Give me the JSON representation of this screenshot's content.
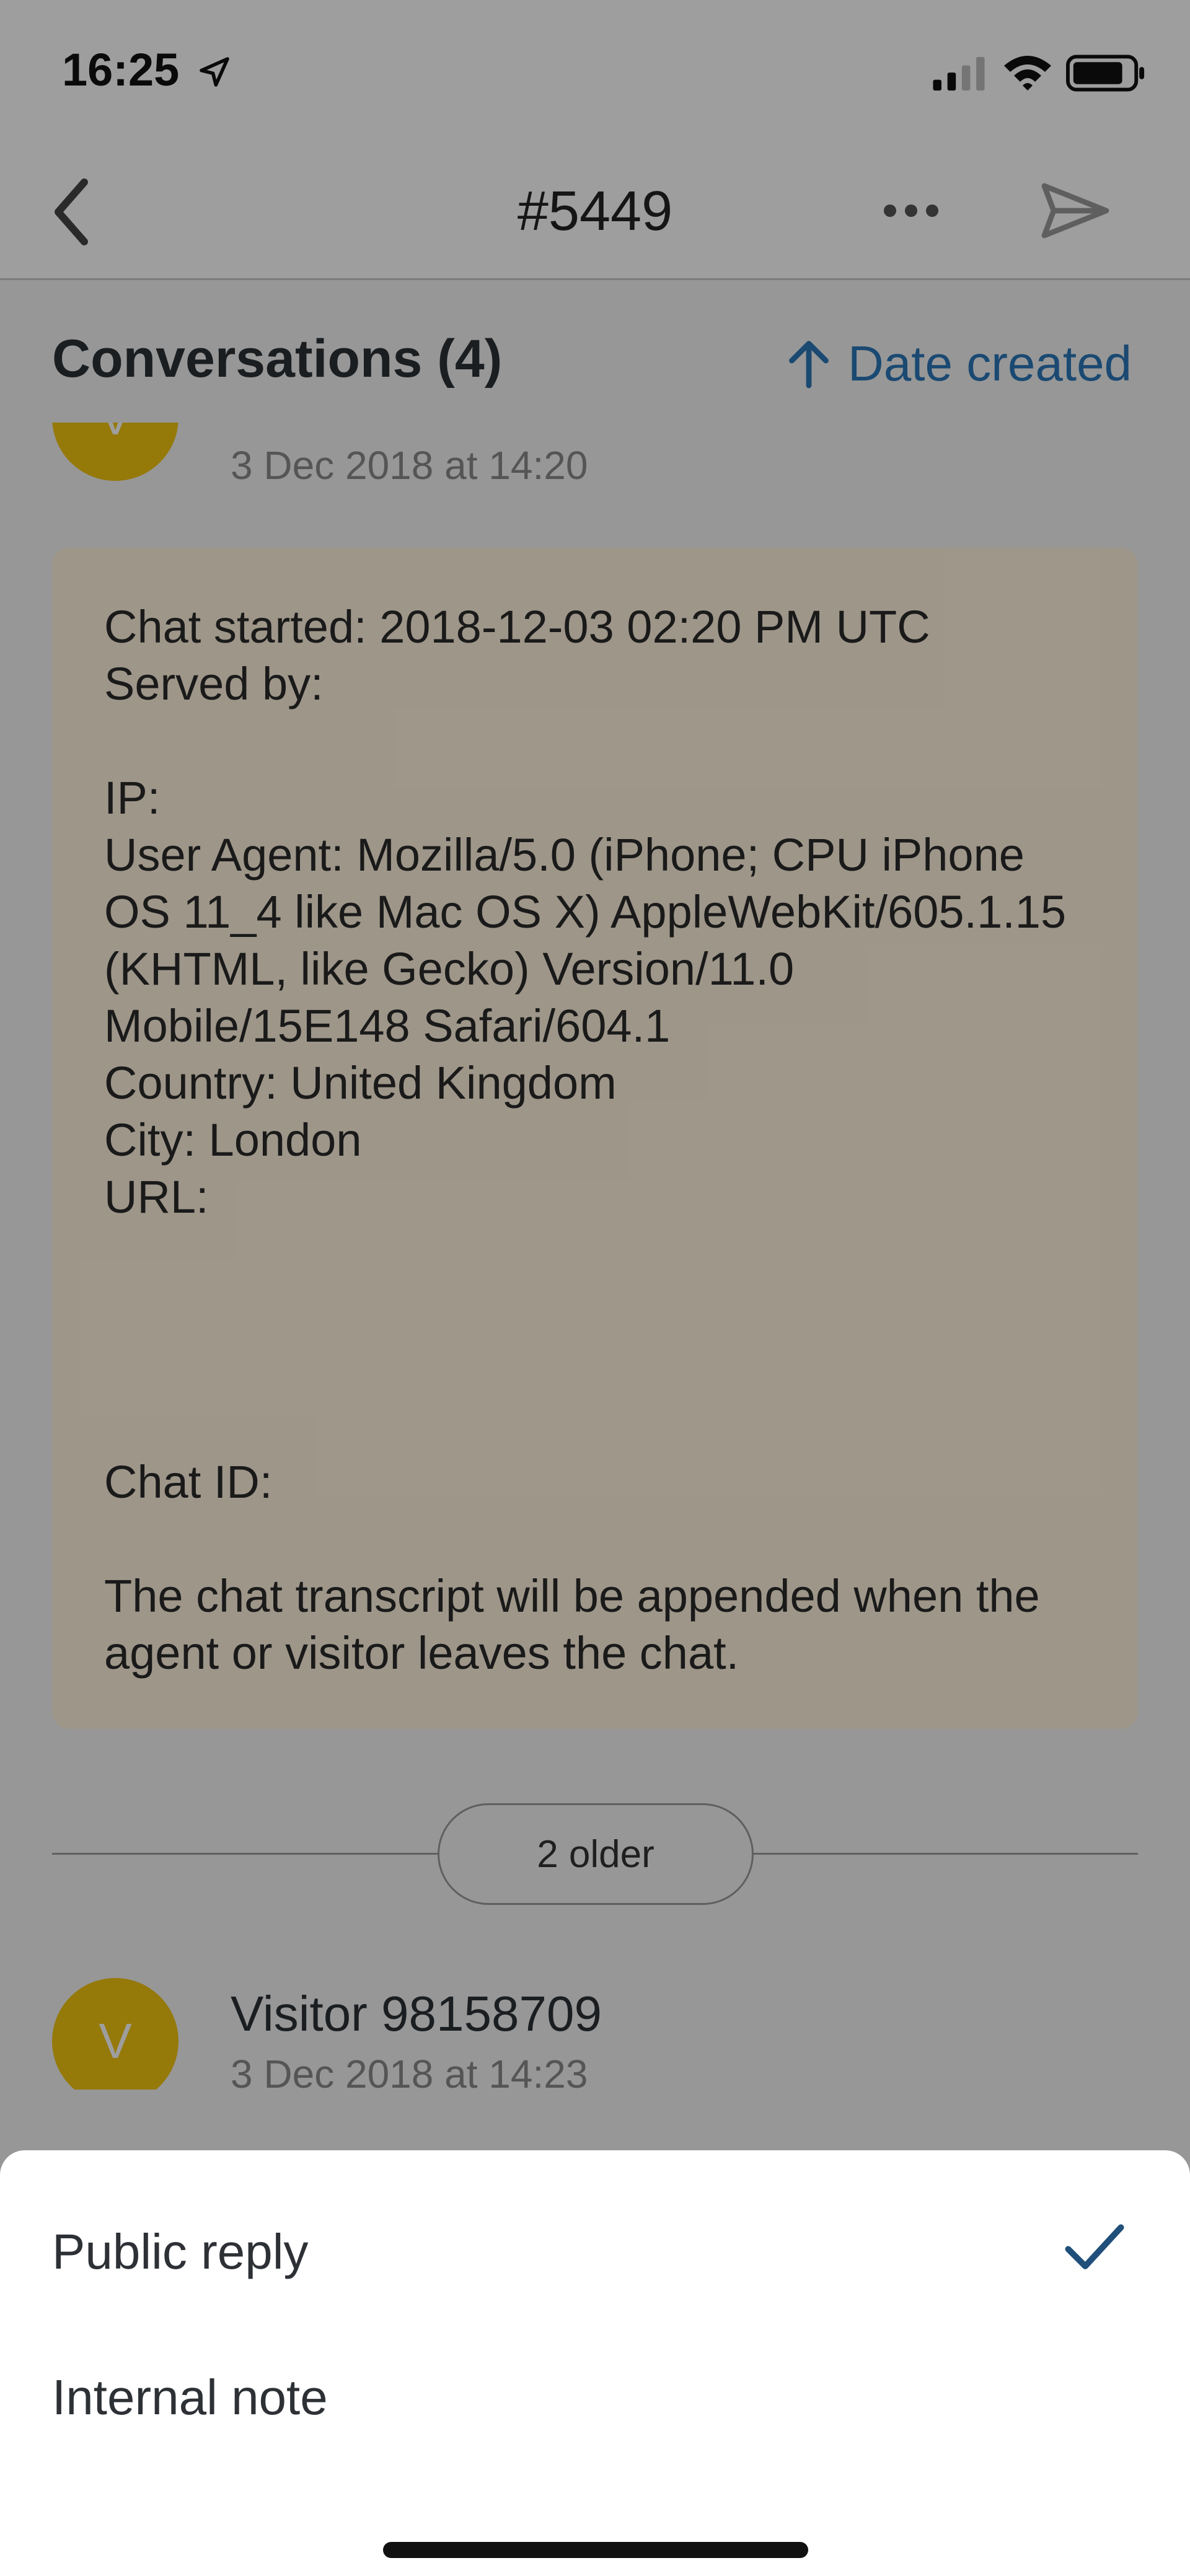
{
  "status_bar": {
    "time": "16:25"
  },
  "nav": {
    "title": "#5449"
  },
  "conversations": {
    "title": "Conversations (4)",
    "sort_label": "Date created"
  },
  "first_message": {
    "avatar_initial": "V",
    "date": "3 Dec 2018 at 14:20",
    "body": "Chat started: 2018-12-03 02:20 PM UTC\nServed by:\n\nIP:\nUser Agent: Mozilla/5.0 (iPhone; CPU iPhone OS 11_4 like Mac OS X) AppleWebKit/605.1.15 (KHTML, like Gecko) Version/11.0 Mobile/15E148 Safari/604.1\nCountry: United Kingdom\nCity: London\nURL:\n\n\n\n\nChat ID:\n\nThe chat transcript will be appended when the agent or visitor leaves the chat."
  },
  "older_button": {
    "label": "2 older"
  },
  "second_message": {
    "avatar_initial": "V",
    "name": "Visitor 98158709",
    "date": "3 Dec 2018 at 14:23"
  },
  "sheet": {
    "options": [
      {
        "label": "Public reply",
        "selected": true
      },
      {
        "label": "Internal note",
        "selected": false
      }
    ]
  },
  "colors": {
    "accent": "#2a77b8",
    "bubble": "#fff3de",
    "avatar": "#f1c40f",
    "check": "#1f4f7a"
  }
}
